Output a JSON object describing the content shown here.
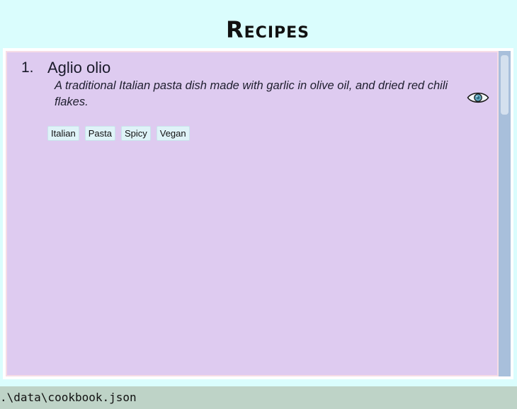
{
  "app": {
    "title": "Recipes"
  },
  "recipes": [
    {
      "index": "1.",
      "name": "Aglio olio",
      "description": "A traditional Italian pasta dish made with garlic in olive oil, and dried red chili flakes.",
      "tags": [
        "Italian",
        "Pasta",
        "Spicy",
        "Vegan"
      ],
      "view_icon": "eye-icon"
    }
  ],
  "status_bar": {
    "path": ".\\data\\cookbook.json"
  },
  "colors": {
    "background": "#dafdfd",
    "list_background": "#decbf0",
    "tag_background": "#dff3f8",
    "scrollbar": "#a8bfdb",
    "status_bar": "#bed3c7"
  }
}
